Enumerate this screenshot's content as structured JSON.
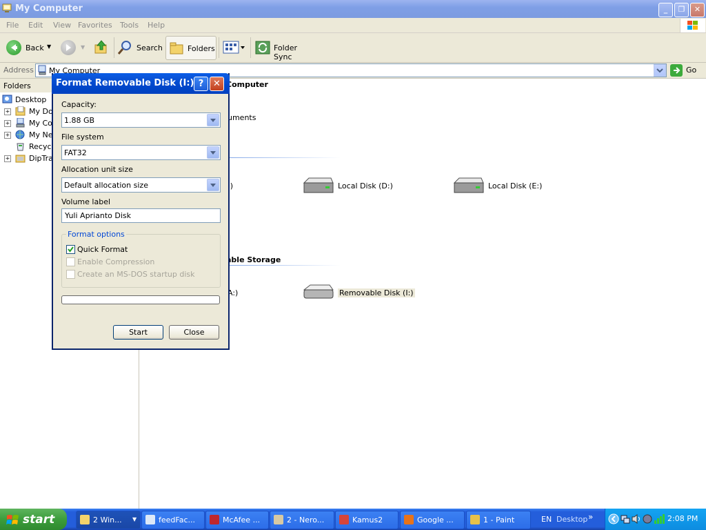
{
  "window": {
    "title": "My Computer",
    "controls": {
      "minimize": "_",
      "restore": "❐",
      "close": "✕"
    }
  },
  "menu": [
    "File",
    "Edit",
    "View",
    "Favorites",
    "Tools",
    "Help"
  ],
  "toolbar": {
    "back": "Back",
    "search": "Search",
    "folders": "Folders",
    "folder_sync": "Folder Sync"
  },
  "address": {
    "label": "Address",
    "value": "My Computer",
    "go": "Go"
  },
  "folders_pane": {
    "header": "Folders",
    "items": [
      {
        "label": "Desktop"
      },
      {
        "label": "My Doc"
      },
      {
        "label": "My Com"
      },
      {
        "label": "My Net"
      },
      {
        "label": "Recycl"
      },
      {
        "label": "DipTra"
      }
    ]
  },
  "content": {
    "groups": [
      {
        "title": "Computer",
        "visible_prefix": ""
      },
      {
        "title": "able Storage"
      }
    ],
    "shared_docs_fragment": "uments",
    "hard_drives": [
      {
        "label": ":)",
        "fragment": true
      },
      {
        "label": "Local Disk (D:)"
      },
      {
        "label": "Local Disk (E:)"
      }
    ],
    "removable": [
      {
        "label": "A:)",
        "fragment": true
      },
      {
        "label": "Removable Disk (I:)"
      }
    ]
  },
  "dialog": {
    "title": "Format Removable Disk (I:)",
    "help": "?",
    "close_x": "✕",
    "capacity_label": "Capacity:",
    "capacity_value": "1.88 GB",
    "filesystem_label": "File system",
    "filesystem_value": "FAT32",
    "alloc_label": "Allocation unit size",
    "alloc_value": "Default allocation size",
    "volume_label": "Volume label",
    "volume_value": "Yuli Aprianto Disk",
    "format_options": "Format options",
    "quick_format": "Quick Format",
    "quick_format_checked": true,
    "enable_compression": "Enable Compression",
    "msdos_startup": "Create an MS-DOS startup disk",
    "progress": 0,
    "start": "Start",
    "close": "Close"
  },
  "taskbar": {
    "start": "start",
    "buttons": [
      {
        "label": "2 Win..."
      },
      {
        "label": "feedFac..."
      },
      {
        "label": "McAfee ..."
      },
      {
        "label": "2 - Nero..."
      },
      {
        "label": "Kamus2"
      },
      {
        "label": "Google ..."
      },
      {
        "label": "1 - Paint"
      }
    ],
    "lang": "EN",
    "desktop": "Desktop",
    "chevron": "»",
    "time": "2:08 PM"
  },
  "colors": {
    "xp_blue": "#0a246a",
    "dialog_bg": "#ece9d8",
    "start_green": "#3c9d3c",
    "taskbar_blue": "#245edb",
    "accent_link": "#0046d5"
  }
}
